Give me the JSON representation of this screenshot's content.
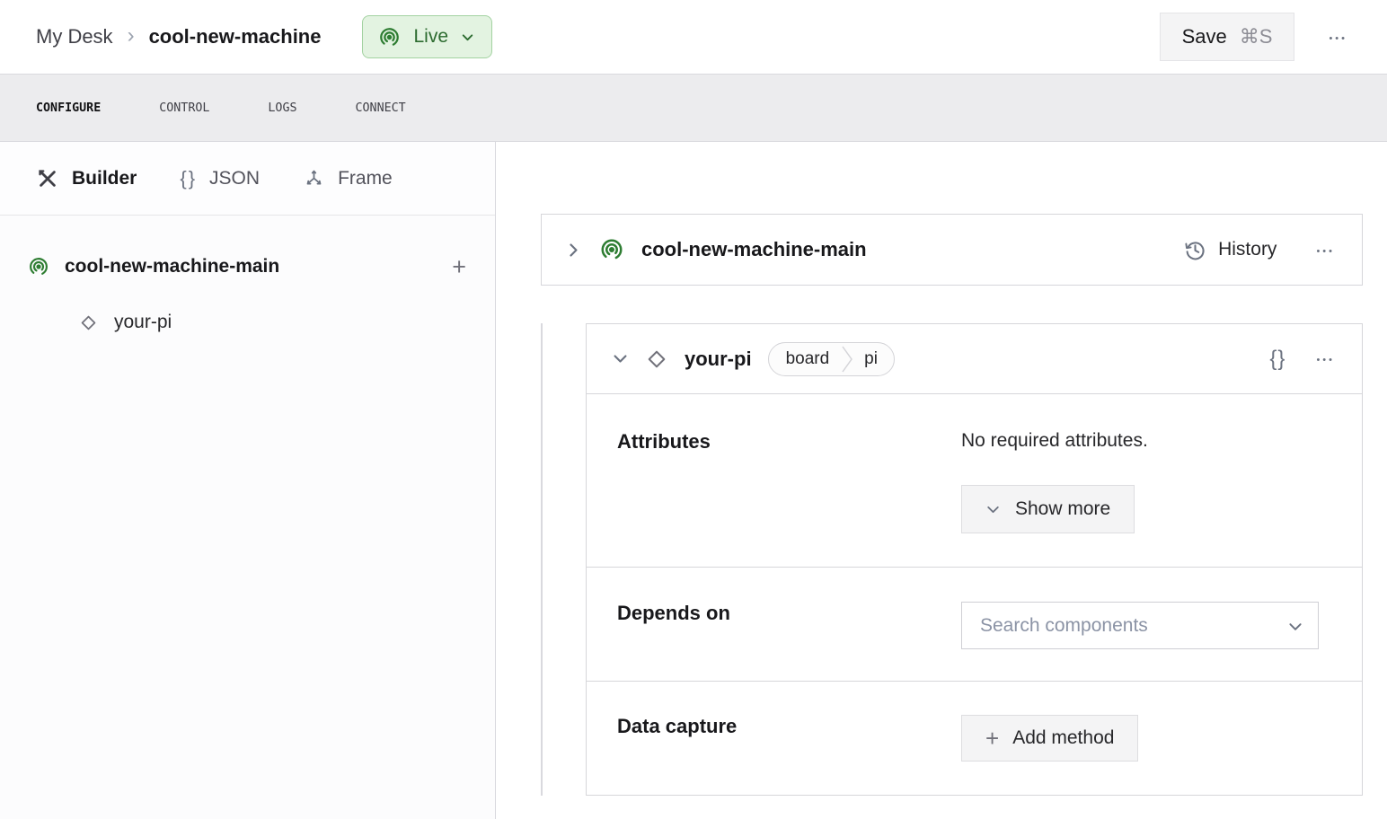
{
  "glyphs": {
    "ellipsis": "•••",
    "plus": "+",
    "braces": "{}",
    "breadcrumb_separator": "›"
  },
  "header": {
    "breadcrumb": {
      "parent": "My Desk",
      "current": "cool-new-machine"
    },
    "live": {
      "label": "Live"
    },
    "save": {
      "label": "Save",
      "shortcut": "⌘S"
    }
  },
  "tabs": [
    {
      "label": "CONFIGURE"
    },
    {
      "label": "CONTROL"
    },
    {
      "label": "LOGS"
    },
    {
      "label": "CONNECT"
    }
  ],
  "sidebar": {
    "modes": [
      {
        "label": "Builder"
      },
      {
        "label": "JSON"
      },
      {
        "label": "Frame"
      }
    ],
    "tree": {
      "part": {
        "label": "cool-new-machine-main"
      },
      "component": {
        "label": "your-pi"
      }
    }
  },
  "main": {
    "part_card": {
      "title": "cool-new-machine-main",
      "history_label": "History"
    },
    "component_card": {
      "title": "your-pi",
      "badge": {
        "type": "board",
        "model": "pi"
      },
      "attributes": {
        "label": "Attributes",
        "empty_text": "No required attributes.",
        "show_more_label": "Show more"
      },
      "depends_on": {
        "label": "Depends on",
        "search_placeholder": "Search components"
      },
      "data_capture": {
        "label": "Data capture",
        "add_method_label": "Add method"
      }
    }
  },
  "colors": {
    "accent_green": "#2e7d32",
    "live_bg": "#e3f3e1",
    "live_border": "#a3d2a1",
    "live_text": "#2c6b2f",
    "card_border": "#d6d6da",
    "tabbar_bg": "#ececee"
  }
}
